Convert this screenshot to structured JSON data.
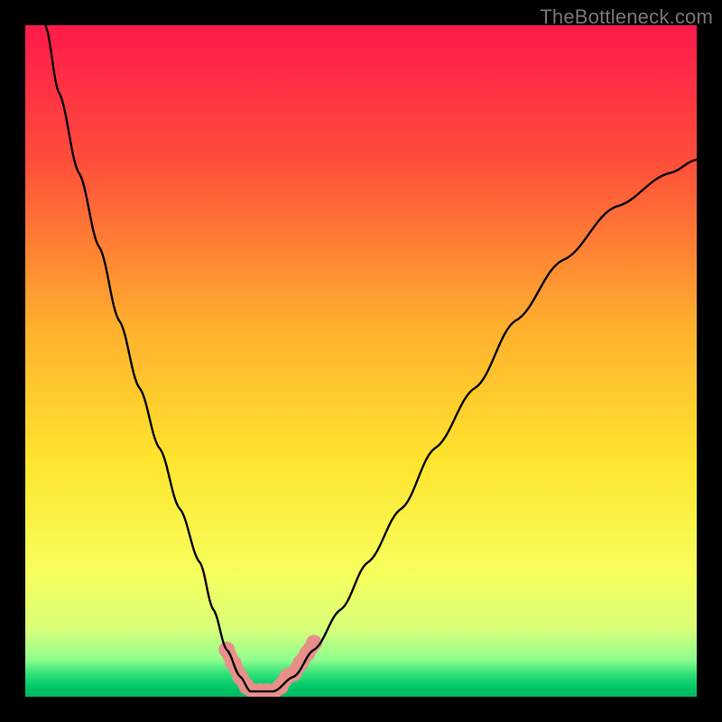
{
  "watermark": "TheBottleneck.com",
  "chart_data": {
    "type": "line",
    "title": "",
    "xlabel": "",
    "ylabel": "",
    "xlim": [
      0,
      100
    ],
    "ylim": [
      0,
      100
    ],
    "series": [
      {
        "name": "bottleneck-curve",
        "x": [
          3,
          5,
          8,
          11,
          14,
          17,
          20,
          23,
          26,
          28,
          30,
          32,
          33.5,
          35,
          37,
          40,
          43,
          47,
          51,
          56,
          61,
          67,
          73,
          80,
          88,
          96,
          100
        ],
        "y": [
          100,
          90,
          78,
          67,
          56,
          46,
          37,
          28,
          20,
          13,
          7,
          3,
          0.8,
          0.8,
          0.8,
          3,
          7,
          13,
          20,
          28,
          37,
          46,
          56,
          65,
          73,
          78,
          80
        ]
      }
    ],
    "highlight_points": {
      "name": "marked-range",
      "x": [
        30,
        31,
        32,
        33,
        34,
        35,
        36,
        37,
        38,
        39,
        40,
        41,
        42,
        43
      ],
      "y": [
        7,
        5,
        3,
        1.5,
        0.8,
        0.8,
        0.8,
        0.8,
        1.5,
        3,
        3.5,
        5,
        6.5,
        8
      ]
    },
    "gradient_stops": [
      {
        "offset": 0.0,
        "color": "#ff1a4b"
      },
      {
        "offset": 0.2,
        "color": "#ff4d3a"
      },
      {
        "offset": 0.45,
        "color": "#ffb02e"
      },
      {
        "offset": 0.65,
        "color": "#ffe52e"
      },
      {
        "offset": 0.82,
        "color": "#f6ff5e"
      },
      {
        "offset": 0.9,
        "color": "#d8ff7a"
      },
      {
        "offset": 0.945,
        "color": "#8eff8e"
      },
      {
        "offset": 0.965,
        "color": "#35e27a"
      },
      {
        "offset": 0.985,
        "color": "#00c86a"
      },
      {
        "offset": 1.0,
        "color": "#00b85f"
      }
    ],
    "highlight_color": "#e98f8a",
    "curve_color": "#000000"
  }
}
